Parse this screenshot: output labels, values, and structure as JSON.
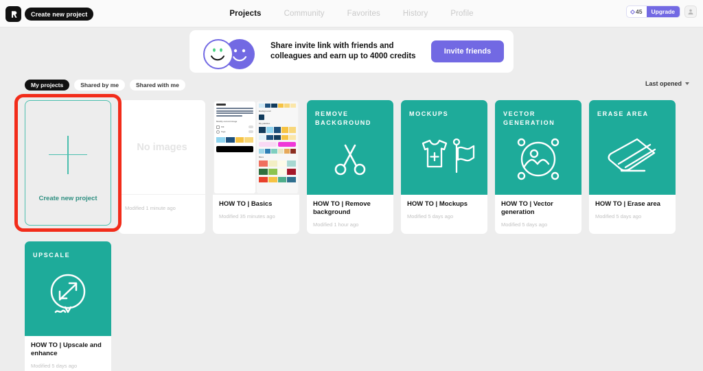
{
  "topbar": {
    "logo_icon": "brand-logo-icon",
    "create_new_project_label": "Create new project",
    "nav": [
      {
        "label": "Projects",
        "active": true
      },
      {
        "label": "Community",
        "active": false
      },
      {
        "label": "Favorites",
        "active": false
      },
      {
        "label": "History",
        "active": false
      },
      {
        "label": "Profile",
        "active": false
      }
    ],
    "credits": {
      "icon": "diamond-icon",
      "value": "45"
    },
    "upgrade_label": "Upgrade",
    "avatar_icon": "user-avatar-icon"
  },
  "banner": {
    "text": "Share invite link with friends and colleagues and earn up to 4000 credits",
    "text_line1": "Share invite link with friends and",
    "text_line2": "colleagues and earn up to 4000 credits",
    "cta_label": "Invite friends",
    "left_icon": "smiley-face-white-icon",
    "right_icon": "smiley-face-purple-icon"
  },
  "filters": {
    "chips": [
      {
        "label": "My projects",
        "active": true
      },
      {
        "label": "Shared by me",
        "active": false
      },
      {
        "label": "Shared with me",
        "active": false
      }
    ],
    "sort_label": "Last opened",
    "sort_icon": "chevron-down-icon"
  },
  "create_card": {
    "label": "Create new project",
    "icon": "plus-icon",
    "highlighted": true,
    "highlight_color": "#f22c1a",
    "accent_color": "#4bbfae"
  },
  "projects": [
    {
      "kind": "no-images",
      "thumb_text": "No images",
      "title": "",
      "meta": "Modified 1 minute ago"
    },
    {
      "kind": "screenshot",
      "title": "HOW TO | Basics",
      "meta": "Modified 35 minutes ago",
      "thumb_labels": {
        "prompt": "urban landscape with a view of ancient buildings framed by centuries-old trees and vintage lanterns",
        "modify": "Modify current image",
        "fill": "Fill",
        "sign": "Sign",
        "generate": "Recraft",
        "background": "Background",
        "my_palettes": "My palettes",
        "more": "More"
      }
    },
    {
      "kind": "tool",
      "kicker": "Remove background",
      "icon": "scissors-icon",
      "title": "HOW TO | Remove background",
      "meta": "Modified 1 hour ago"
    },
    {
      "kind": "tool",
      "kicker": "Mockups",
      "icon": "tshirt-flag-icon",
      "title": "HOW TO | Mockups",
      "meta": "Modified 5 days ago"
    },
    {
      "kind": "tool",
      "kicker": "Vector generation",
      "icon": "vector-image-icon",
      "title": "HOW TO | Vector generation",
      "meta": "Modified 5 days ago"
    },
    {
      "kind": "tool",
      "kicker": "Erase area",
      "icon": "eraser-icon",
      "title": "HOW TO | Erase area",
      "meta": "Modified 5 days ago"
    },
    {
      "kind": "tool",
      "kicker": "Upscale",
      "icon": "upscale-arrows-icon",
      "title": "HOW TO | Upscale and enhance",
      "meta": "Modified 5 days ago"
    }
  ],
  "colors": {
    "teal": "#1eab9a",
    "purple": "#7269e3",
    "dark": "#111111",
    "page_bg": "#ededed",
    "highlight_red": "#f22c1a"
  }
}
